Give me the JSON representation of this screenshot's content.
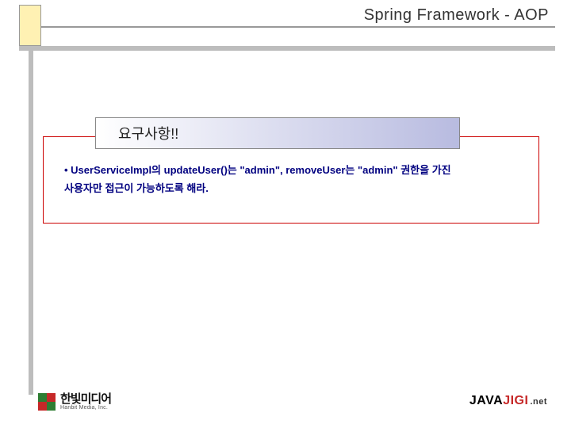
{
  "header": {
    "title": "Spring Framework - AOP"
  },
  "callout": {
    "title": "요구사항!!"
  },
  "requirement": {
    "line1_prefix": "• UserServiceImpl의 updateUser()는 ",
    "line1_q1": "\"admin\"",
    "line1_mid": ", removeUser는 ",
    "line1_q2": "\"admin\"",
    "line1_suffix": " 권한을 가진",
    "line2": "사용자만 접근이 가능하도록 해라."
  },
  "footer": {
    "hanbit_ko": "한빛미디어",
    "hanbit_en": "Hanbit Media, Inc.",
    "javajigi_java": "JAVA",
    "javajigi_jigi": "JIGI",
    "javajigi_net": ".net"
  }
}
